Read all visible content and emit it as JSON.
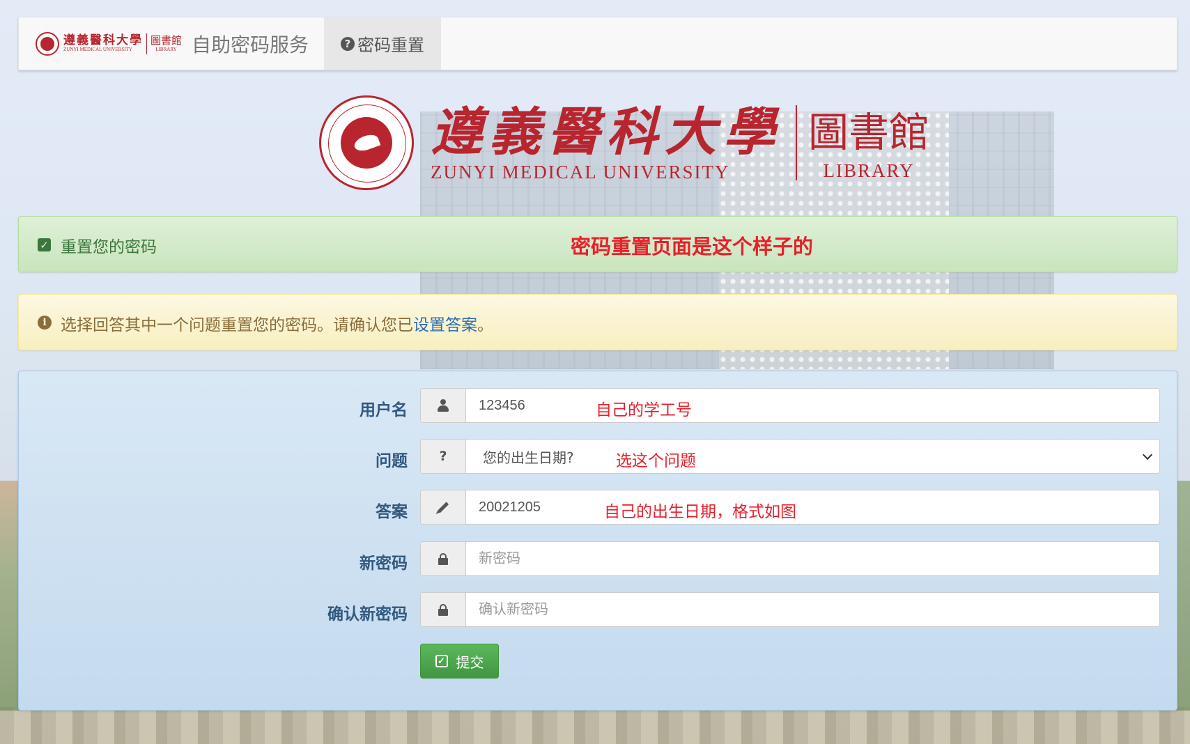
{
  "navbar": {
    "logo_cn": "遵義醫科大學",
    "logo_en": "ZUNYI MEDICAL UNIVERSITY",
    "logo_lib_cn": "圖書館",
    "logo_lib_en": "LIBRARY",
    "brand_title": "自助密码服务",
    "tab_icon": "?",
    "tab_label": "密码重置"
  },
  "hero": {
    "logo_cn": "遵義醫科大學",
    "logo_en": "ZUNYI MEDICAL UNIVERSITY",
    "lib_cn": "圖書館",
    "lib_en": "LIBRARY"
  },
  "alert_success": {
    "check_glyph": "✓",
    "text": "重置您的密码",
    "annotation": "密码重置页面是这个样子的"
  },
  "alert_warning": {
    "info_glyph": "i",
    "text_before": "选择回答其中一个问题重置您的密码。请确认您已",
    "link_text": "设置答案",
    "text_after": "。"
  },
  "form": {
    "username": {
      "label": "用户名",
      "value": "123456",
      "annotation": "自己的学工号"
    },
    "question": {
      "label": "问题",
      "addon": "?",
      "selected": "您的出生日期?",
      "annotation": "选这个问题"
    },
    "answer": {
      "label": "答案",
      "value": "20021205",
      "annotation": "自己的出生日期，格式如图"
    },
    "new_password": {
      "label": "新密码",
      "placeholder": "新密码"
    },
    "confirm_password": {
      "label": "确认新密码",
      "placeholder": "确认新密码"
    },
    "submit": {
      "check_glyph": "✓",
      "label": "提交"
    }
  },
  "colors": {
    "brand_red": "#b8252f",
    "annotation_red": "#e8202a",
    "success_text": "#3c763d",
    "warning_text": "#8a6d3b",
    "label_blue": "#31587d",
    "submit_green": "#5cb85c"
  },
  "icons": {
    "username_addon": "user-icon",
    "question_addon": "question-icon",
    "answer_addon": "pencil-icon",
    "password_addon": "lock-icon"
  }
}
